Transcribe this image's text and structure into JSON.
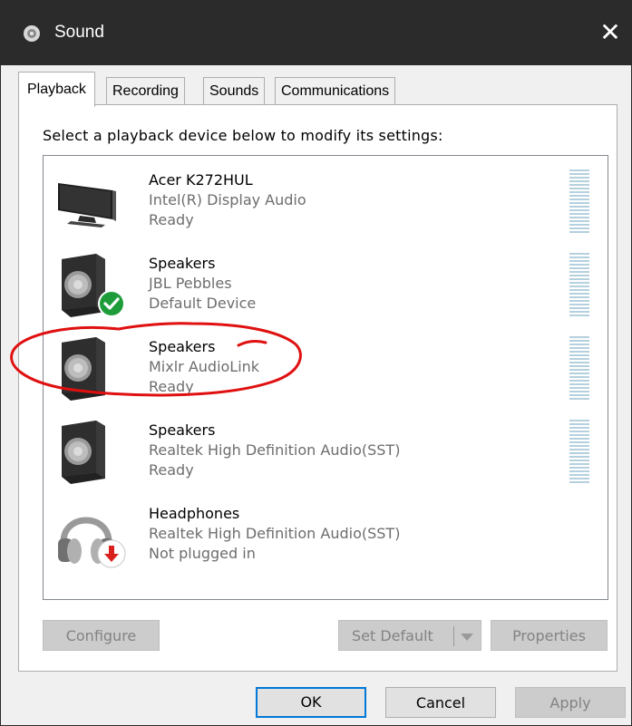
{
  "window": {
    "title": "Sound",
    "icon": "speaker-icon",
    "close_glyph": "✕"
  },
  "tabs": [
    {
      "label": "Playback",
      "active": true
    },
    {
      "label": "Recording",
      "active": false
    },
    {
      "label": "Sounds",
      "active": false
    },
    {
      "label": "Communications",
      "active": false
    }
  ],
  "instruction": "Select a playback device below to modify its settings:",
  "devices": [
    {
      "name": "Acer K272HUL",
      "description": "Intel(R) Display Audio",
      "status": "Ready",
      "icon": "monitor-icon"
    },
    {
      "name": "Speakers",
      "description": "JBL Pebbles",
      "status": "Default Device",
      "icon": "speaker-icon",
      "badge": "default-check-icon"
    },
    {
      "name": "Speakers",
      "description": "Mixlr AudioLink",
      "status": "Ready",
      "icon": "speaker-icon"
    },
    {
      "name": "Speakers",
      "description": "Realtek High Definition Audio(SST)",
      "status": "Ready",
      "icon": "speaker-icon"
    },
    {
      "name": "Headphones",
      "description": "Realtek High Definition Audio(SST)",
      "status": "Not plugged in",
      "icon": "headphones-icon",
      "badge": "unplugged-arrow-icon"
    }
  ],
  "buttons": {
    "configure": "Configure",
    "set_default": "Set Default",
    "properties": "Properties",
    "ok": "OK",
    "cancel": "Cancel",
    "apply": "Apply"
  },
  "colors": {
    "titlebar": "#2b2b2b",
    "annotation": "#e01010",
    "default_check": "#1e9c3a",
    "unplugged_badge": "#d9201c",
    "focus_border": "#0078d7",
    "meter": "#b5d0de"
  }
}
